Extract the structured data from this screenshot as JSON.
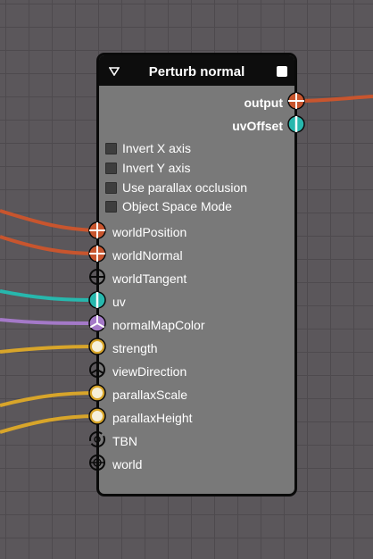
{
  "node": {
    "title": "Perturb normal",
    "outputs": [
      {
        "label": "output",
        "icon": "vector-port-icon"
      },
      {
        "label": "uvOffset",
        "icon": "vector2-port-icon"
      }
    ],
    "options": [
      {
        "label": "Invert X axis",
        "checked": false
      },
      {
        "label": "Invert Y axis",
        "checked": false
      },
      {
        "label": "Use parallax occlusion",
        "checked": false
      },
      {
        "label": "Object Space Mode",
        "checked": false
      }
    ],
    "inputs": [
      {
        "label": "worldPosition",
        "icon": "vector-port-icon",
        "connected": true
      },
      {
        "label": "worldNormal",
        "icon": "vector-port-icon",
        "connected": true
      },
      {
        "label": "worldTangent",
        "icon": "vector-port-icon",
        "connected": false
      },
      {
        "label": "uv",
        "icon": "vector2-port-icon",
        "connected": true
      },
      {
        "label": "normalMapColor",
        "icon": "color-port-icon",
        "connected": true
      },
      {
        "label": "strength",
        "icon": "float-port-icon",
        "connected": true
      },
      {
        "label": "viewDirection",
        "icon": "vector3-port-icon",
        "connected": false
      },
      {
        "label": "parallaxScale",
        "icon": "float-port-icon",
        "connected": true
      },
      {
        "label": "parallaxHeight",
        "icon": "float-port-icon",
        "connected": true
      },
      {
        "label": "TBN",
        "icon": "matrix-port-icon",
        "connected": false
      },
      {
        "label": "world",
        "icon": "matrix4-port-icon",
        "connected": false
      }
    ]
  },
  "colors": {
    "canvas": "#5b575b",
    "node_body": "#797979",
    "header": "#0d0d0d",
    "vector": "#c8552e",
    "vector2": "#27b7ad",
    "color": "#a479c8",
    "float": "#d8a52a"
  }
}
